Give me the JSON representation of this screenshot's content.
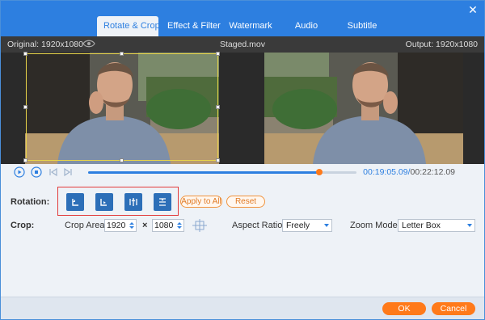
{
  "tabs": [
    {
      "label": "Rotate & Crop"
    },
    {
      "label": "Effect & Filter"
    },
    {
      "label": "Watermark"
    },
    {
      "label": "Audio"
    },
    {
      "label": "Subtitle"
    }
  ],
  "info": {
    "original": "Original: 1920x1080",
    "filename": "Staged.mov",
    "output": "Output: 1920x1080"
  },
  "playback": {
    "current_time": "00:19:05.09",
    "separator": "/",
    "total_time": "00:22:12.09",
    "progress": 0.86
  },
  "rotation": {
    "label": "Rotation:",
    "apply_all": "Apply to All",
    "reset": "Reset"
  },
  "crop": {
    "label": "Crop:",
    "area_label": "Crop Area:",
    "width": "1920",
    "times": "×",
    "height": "1080",
    "aspect_label": "Aspect Ratio:",
    "aspect_value": "Freely",
    "zoom_label": "Zoom Mode:",
    "zoom_value": "Letter Box"
  },
  "footer": {
    "ok": "OK",
    "cancel": "Cancel"
  },
  "colors": {
    "accent": "#2d7fe0",
    "orange": "#ff7a1a",
    "highlight": "#e23b3b"
  }
}
